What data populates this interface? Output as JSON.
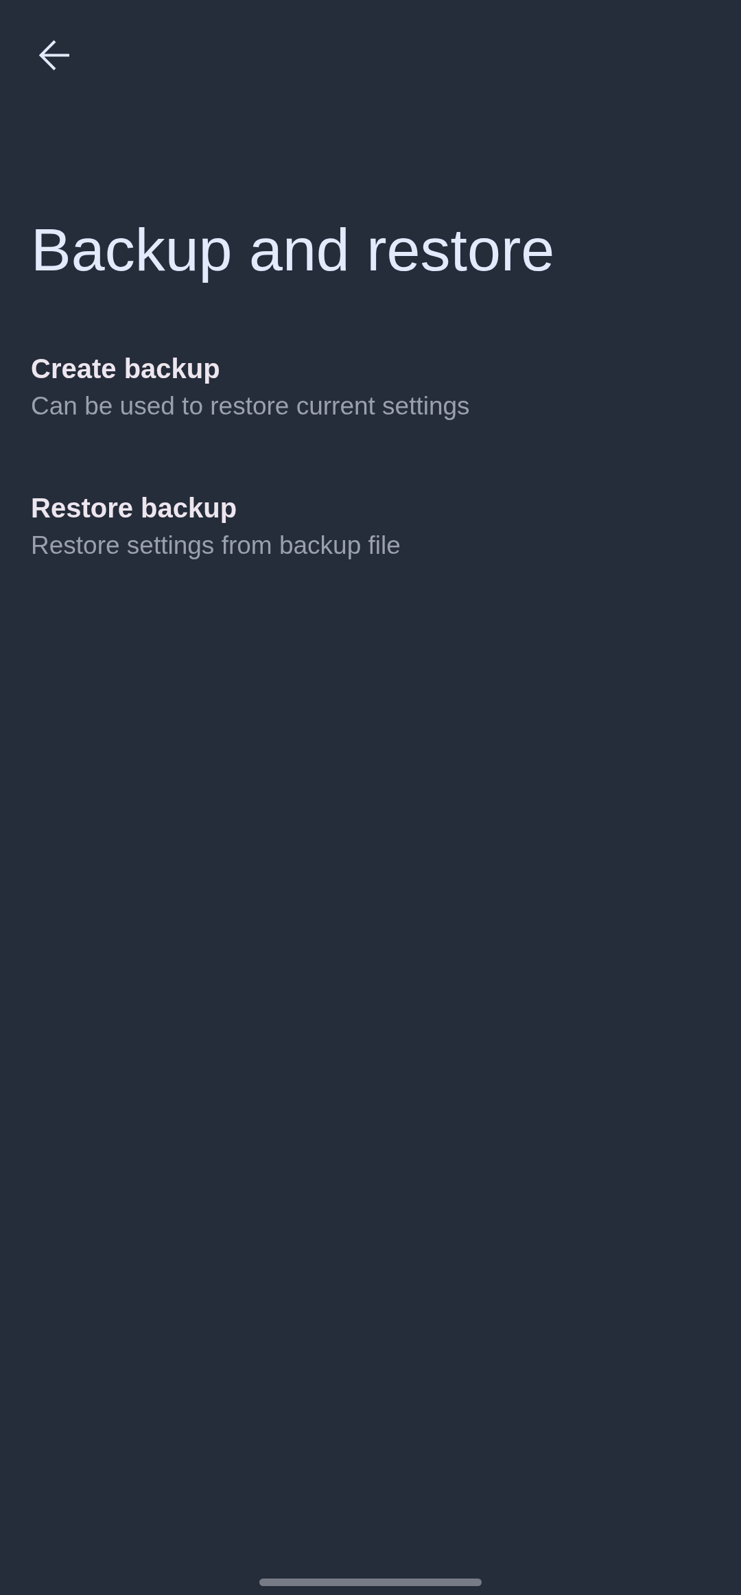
{
  "page": {
    "title": "Backup and restore"
  },
  "options": [
    {
      "title": "Create backup",
      "description": "Can be used to restore current settings"
    },
    {
      "title": "Restore backup",
      "description": "Restore settings from backup file"
    }
  ]
}
